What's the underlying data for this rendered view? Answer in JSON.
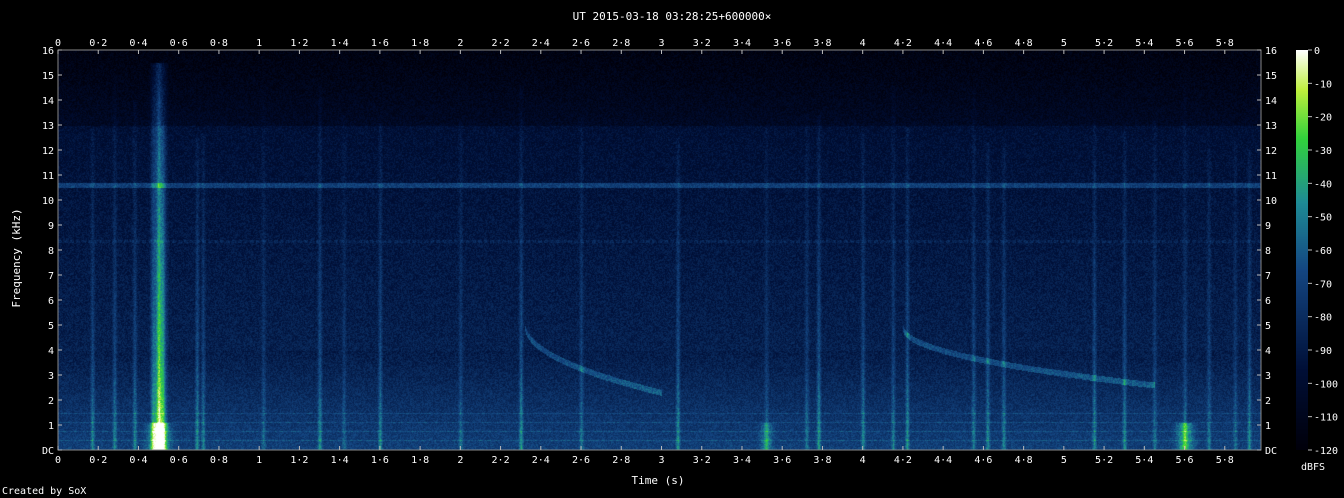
{
  "chart_data": {
    "type": "heatmap",
    "title": "UT 2015-03-18 03:28:25+600000×",
    "xlabel": "Time (s)",
    "ylabel": "Frequency (kHz)",
    "x_ticks": [
      "0",
      "0·2",
      "0·4",
      "0·6",
      "0·8",
      "1",
      "1·2",
      "1·4",
      "1·6",
      "1·8",
      "2",
      "2·2",
      "2·4",
      "2·6",
      "2·8",
      "3",
      "3·2",
      "3·4",
      "3·6",
      "3·8",
      "4",
      "4·2",
      "4·4",
      "4·6",
      "4·8",
      "5",
      "5·2",
      "5·4",
      "5·6",
      "5·8"
    ],
    "y_ticks": [
      "DC",
      "1",
      "2",
      "3",
      "4",
      "5",
      "6",
      "7",
      "8",
      "9",
      "10",
      "11",
      "12",
      "13",
      "14",
      "15",
      "16"
    ],
    "xlim": [
      0,
      5.98
    ],
    "ylim": [
      0,
      16
    ],
    "colorbar": {
      "label": "dBFS",
      "ticks": [
        "0",
        "-10",
        "-20",
        "-30",
        "-40",
        "-50",
        "-60",
        "-70",
        "-80",
        "-90",
        "-100",
        "-110",
        "-120"
      ],
      "range": [
        -120,
        0
      ]
    },
    "features": {
      "carrier_khz": 10.6,
      "faint_line_khz": 8.35,
      "strong_burst_s": 0.5,
      "sweeps": [
        {
          "t_start": 2.32,
          "t_end": 3.0,
          "f_start_khz": 5.0,
          "f_end_khz": 2.3
        },
        {
          "t_start": 4.2,
          "t_end": 5.45,
          "f_start_khz": 4.9,
          "f_end_khz": 2.6
        }
      ],
      "spikes_s": [
        0.17,
        0.28,
        0.38,
        0.47,
        0.5,
        0.52,
        0.69,
        0.72,
        1.02,
        1.3,
        1.42,
        1.6,
        2.0,
        2.3,
        2.6,
        3.08,
        3.52,
        3.72,
        3.78,
        4.0,
        4.15,
        4.22,
        4.55,
        4.62,
        4.7,
        5.15,
        5.3,
        5.45,
        5.6,
        5.72,
        5.85,
        5.92
      ]
    },
    "colors": {
      "low": "#000a2a",
      "mid": "#1f7fa0",
      "high": "#3fe030",
      "peak": "#ffffff"
    }
  },
  "footer": {
    "credit": "Created by SoX"
  }
}
